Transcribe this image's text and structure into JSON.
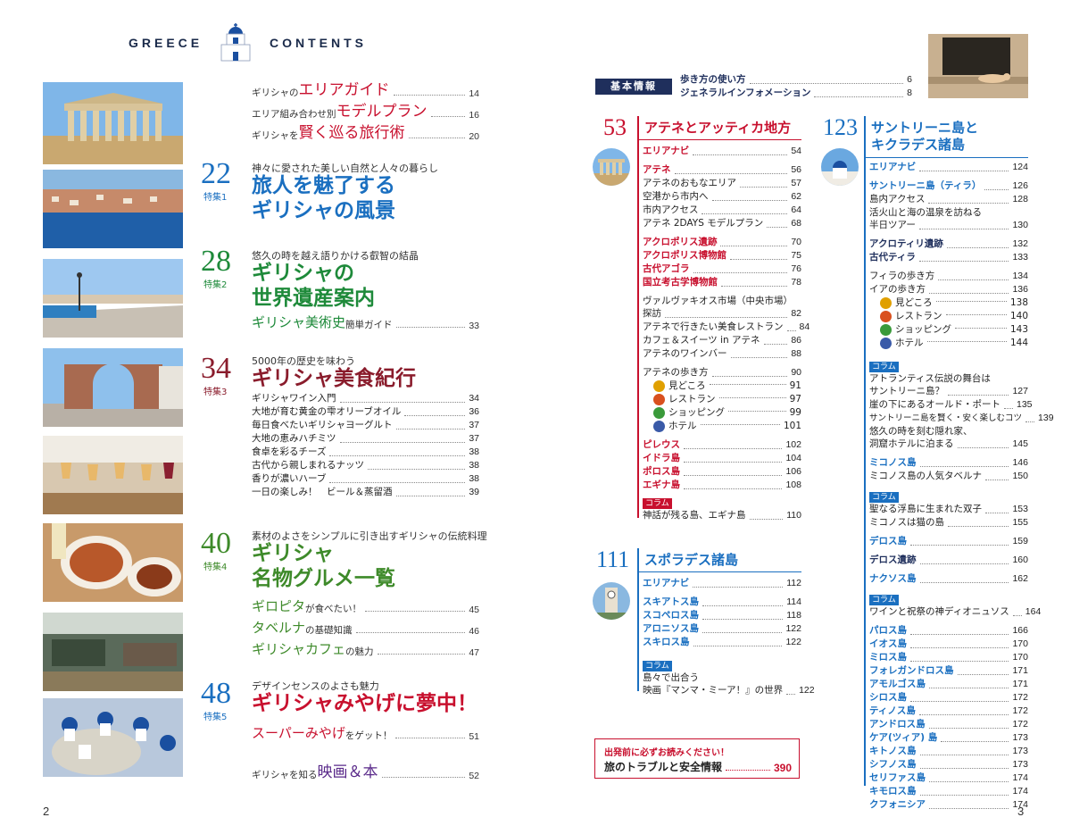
{
  "left_page": {
    "header_left": "GREECE",
    "header_right": "CONTENTS",
    "page_number": "2",
    "intro_items": [
      {
        "prefix": "ギリシャの",
        "highlight": "エリアガイド",
        "page": "14"
      },
      {
        "prefix": "エリア組み合わせ別",
        "highlight": "モデルプラン",
        "page": "16"
      },
      {
        "prefix": "ギリシャを",
        "highlight": "賢く巡る旅行術",
        "page": "20"
      }
    ],
    "features": [
      {
        "number": "22",
        "label": "特集1",
        "lead": "神々に愛された美しい自然と人々の暮らし",
        "title_1": "旅人を魅了する",
        "title_2": "ギリシャの風景",
        "color": "#1a6fc0"
      },
      {
        "number": "28",
        "label": "特集2",
        "lead": "悠久の時を越え語りかける叡智の結晶",
        "title_1": "ギリシャの",
        "title_2": "世界遺産案内",
        "color": "#1e8a3a",
        "sub": {
          "highlight": "ギリシャ美術史",
          "suffix": "簡単ガイド",
          "page": "33"
        }
      },
      {
        "number": "34",
        "label": "特集3",
        "lead": "5000年の歴史を味わう",
        "title_1": "ギリシャ美食紀行",
        "color": "#8a1c2c",
        "items": [
          {
            "text": "ギリシャワイン入門",
            "page": "34"
          },
          {
            "text": "大地が育む黄金の雫オリーブオイル",
            "page": "36"
          },
          {
            "text": "毎日食べたいギリシャヨーグルト",
            "page": "37"
          },
          {
            "text": "大地の恵みハチミツ",
            "page": "37"
          },
          {
            "text": "食卓を彩るチーズ",
            "page": "38"
          },
          {
            "text": "古代から親しまれるナッツ",
            "page": "38"
          },
          {
            "text": "香りが濃いハーブ",
            "page": "38"
          },
          {
            "text": "一日の楽しみ！　ビール＆蒸留酒",
            "page": "39"
          }
        ]
      },
      {
        "number": "40",
        "label": "特集4",
        "lead": "素材のよさをシンプルに引き出すギリシャの伝統料理",
        "title_1": "ギリシャ",
        "title_2": "名物グルメ一覧",
        "color": "#3e8a2a",
        "subs": [
          {
            "highlight": "ギロピタ",
            "suffix": "が食べたい！",
            "page": "45"
          },
          {
            "highlight": "タベルナ",
            "suffix": "の基礎知識",
            "page": "46"
          },
          {
            "highlight": "ギリシャカフェ",
            "suffix": "の魅力",
            "page": "47"
          }
        ]
      },
      {
        "number": "48",
        "label": "特集5",
        "lead": "デザインセンスのよさも魅力",
        "title_1": "ギリシャみやげに夢中！",
        "color": "#c8102e",
        "sub": {
          "highlight": "スーパーみやげ",
          "suffix": "をゲット！",
          "page": "51"
        }
      }
    ],
    "last_item": {
      "prefix": "ギリシャを知る",
      "highlight": "映画＆本",
      "page": "52"
    }
  },
  "right_page": {
    "page_number": "3",
    "kihon_label": "基本情報",
    "kihon_items": [
      {
        "text": "歩き方の使い方",
        "page": "6"
      },
      {
        "text": "ジェネラルインフォメーション",
        "page": "8"
      }
    ],
    "athens": {
      "number": "53",
      "title": "アテネとアッティカ地方",
      "groups": [
        [
          {
            "text": "エリアナビ",
            "page": "54",
            "style": "red"
          }
        ],
        [
          {
            "text": "アテネ",
            "page": "56",
            "style": "red"
          },
          {
            "text": "アテネのおもなエリア",
            "page": "57",
            "style": ""
          },
          {
            "text": "空港から市内へ",
            "page": "62",
            "style": ""
          },
          {
            "text": "市内アクセス",
            "page": "64",
            "style": ""
          },
          {
            "text": "アテネ 2DAYS モデルプラン",
            "page": "68",
            "style": ""
          }
        ],
        [
          {
            "text": "アクロポリス遺跡",
            "page": "70",
            "style": "red"
          },
          {
            "text": "アクロポリス博物館",
            "page": "75",
            "style": "red"
          },
          {
            "text": "古代アゴラ",
            "page": "76",
            "style": "red"
          },
          {
            "text": "国立考古学博物館",
            "page": "78",
            "style": "red"
          }
        ]
      ],
      "market_line_1": "ヴァルヴァキオス市場（中央市場）",
      "market_line_2": "探訪",
      "market_page": "82",
      "items_after": [
        {
          "text": "アテネで行きたい美食レストラン",
          "page": "84"
        },
        {
          "text": "カフェ＆スイーツ in アテネ",
          "page": "86"
        },
        {
          "text": "アテネのワインバー",
          "page": "88"
        }
      ],
      "walk": {
        "text": "アテネの歩き方",
        "page": "90"
      },
      "icons": [
        {
          "text": "見どころ",
          "page": "91",
          "color": "#e0a000"
        },
        {
          "text": "レストラン",
          "page": "97",
          "color": "#d9501e"
        },
        {
          "text": "ショッピング",
          "page": "99",
          "color": "#3a9a3a"
        },
        {
          "text": "ホテル",
          "page": "101",
          "color": "#3a5aa8"
        }
      ],
      "islands": [
        {
          "text": "ピレウス",
          "page": "102"
        },
        {
          "text": "イドラ島",
          "page": "104"
        },
        {
          "text": "ポロス島",
          "page": "106"
        },
        {
          "text": "エギナ島",
          "page": "108"
        }
      ],
      "column_label": "コラム",
      "column_item": {
        "text": "神話が残る島、エギナ島",
        "page": "110"
      }
    },
    "sporades": {
      "number": "111",
      "title": "スポラデス諸島",
      "items": [
        {
          "text": "エリアナビ",
          "page": "112"
        },
        {
          "text": "スキアトス島",
          "page": "114"
        },
        {
          "text": "スコペロス島",
          "page": "118"
        },
        {
          "text": "アロニソス島",
          "page": "122"
        },
        {
          "text": "スキロス島",
          "page": "122"
        }
      ],
      "column_label": "コラム",
      "column_line_1": "島々で出合う",
      "column_line_2": "映画『マンマ・ミーア！』の世界",
      "column_page": "122"
    },
    "notice": {
      "line_1": "出発前に必ずお読みください！",
      "line_2": "旅のトラブルと安全情報",
      "page": "390"
    },
    "santorini": {
      "number": "123",
      "title_1": "サントリーニ島と",
      "title_2": "キクラデス諸島",
      "items_a": [
        {
          "text": "エリアナビ",
          "page": "124",
          "style": "blue"
        }
      ],
      "items_b": [
        {
          "text": "サントリーニ島（ティラ）",
          "page": "126",
          "style": "blue"
        },
        {
          "text": "島内アクセス",
          "page": "128",
          "style": ""
        }
      ],
      "volcano_line_1": "活火山と海の温泉を訪ねる",
      "volcano_line_2": "半日ツアー",
      "volcano_page": "130",
      "items_c": [
        {
          "text": "アクロティリ遺跡",
          "page": "132",
          "style": "navy"
        },
        {
          "text": "古代ティラ",
          "page": "133",
          "style": "navy"
        }
      ],
      "items_d": [
        {
          "text": "フィラの歩き方",
          "page": "134"
        },
        {
          "text": "イアの歩き方",
          "page": "136"
        }
      ],
      "icons": [
        {
          "text": "見どころ",
          "page": "138",
          "color": "#e0a000"
        },
        {
          "text": "レストラン",
          "page": "140",
          "color": "#d9501e"
        },
        {
          "text": "ショッピング",
          "page": "143",
          "color": "#3a9a3a"
        },
        {
          "text": "ホテル",
          "page": "144",
          "color": "#3a5aa8"
        }
      ],
      "column_label": "コラム",
      "column_a_line_1": "アトランティス伝説の舞台は",
      "column_a_line_2": "サントリーニ島？",
      "column_a_page": "127",
      "column_b": {
        "text": "崖の下にあるオールド・ポート",
        "page": "135"
      },
      "column_c": {
        "text": "サントリーニ島を賢く・安く楽しむコツ",
        "page": "139"
      },
      "column_d_line_1": "悠久の時を刻む隠れ家、",
      "column_d_line_2": "洞窟ホテルに泊まる",
      "column_d_page": "145",
      "mykonos": {
        "text": "ミコノス島",
        "page": "146"
      },
      "mykonos_tav": {
        "text": "ミコノス島の人気タベルナ",
        "page": "150"
      },
      "column2_a": {
        "text": "聖なる浮島に生まれた双子",
        "page": "153"
      },
      "column2_b": {
        "text": "ミコノスは猫の島",
        "page": "155"
      },
      "delos": {
        "text": "デロス島",
        "page": "159"
      },
      "delos_ruins": {
        "text": "デロス遺跡",
        "page": "160"
      },
      "naxos": {
        "text": "ナクソス島",
        "page": "162"
      },
      "column3": {
        "text": "ワインと祝祭の神ディオニュソス",
        "page": "164"
      },
      "islands": [
        {
          "text": "パロス島",
          "page": "166"
        },
        {
          "text": "イオス島",
          "page": "170"
        },
        {
          "text": "ミロス島",
          "page": "170"
        },
        {
          "text": "フォレガンドロス島",
          "page": "171"
        },
        {
          "text": "アモルゴス島",
          "page": "171"
        },
        {
          "text": "シロス島",
          "page": "172"
        },
        {
          "text": "ティノス島",
          "page": "172"
        },
        {
          "text": "アンドロス島",
          "page": "172"
        },
        {
          "text": "ケア(ツィア) 島",
          "page": "173"
        },
        {
          "text": "キトノス島",
          "page": "173"
        },
        {
          "text": "シフノス島",
          "page": "173"
        },
        {
          "text": "セリファス島",
          "page": "174"
        },
        {
          "text": "キモロス島",
          "page": "174"
        },
        {
          "text": "クフォニシア",
          "page": "174"
        }
      ]
    },
    "colors": {
      "red": "#c8102e",
      "blue": "#1a6fc0",
      "navy": "#1f2f5c",
      "column_red": "#c8102e",
      "column_blue": "#1a6fc0"
    }
  }
}
